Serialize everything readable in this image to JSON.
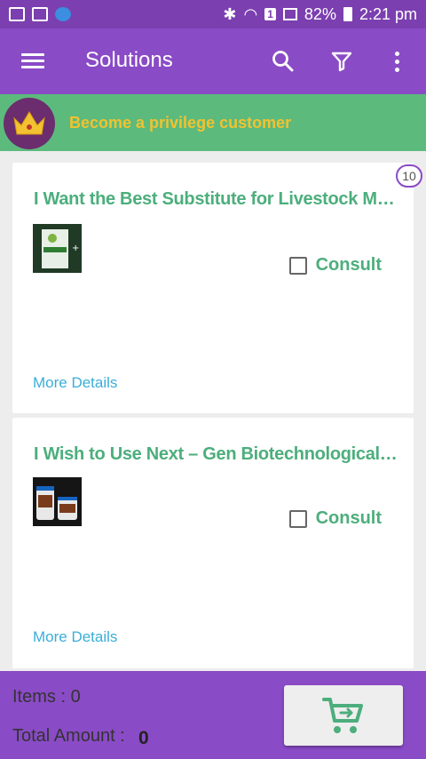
{
  "status_bar": {
    "battery": "82%",
    "time": "2:21 pm",
    "sim_slot": "1"
  },
  "app_bar": {
    "title": "Solutions",
    "icons": [
      "menu-icon",
      "search-icon",
      "filter-icon",
      "more-vert-icon"
    ]
  },
  "banner": {
    "text": "Become a privilege customer",
    "icon": "crown-icon"
  },
  "list": {
    "count_badge": "10",
    "items": [
      {
        "title": "I Want the Best Substitute for Livestock M…",
        "consult_label": "Consult",
        "consult_checked": false,
        "more_details": "More Details"
      },
      {
        "title": "I Wish to Use Next – Gen Biotechnological…",
        "consult_label": "Consult",
        "consult_checked": false,
        "more_details": "More Details"
      }
    ]
  },
  "bottom_bar": {
    "items_label": "Items :  0",
    "amount_label": "Total Amount : ",
    "amount_value": "0",
    "cart_icon": "cart-icon"
  },
  "colors": {
    "primary": "#8a4bc6",
    "status_bar": "#7b3fb0",
    "banner": "#5cba7d",
    "banner_text": "#f2c230",
    "accent_green": "#4cae7c",
    "link": "#3aaed8"
  }
}
